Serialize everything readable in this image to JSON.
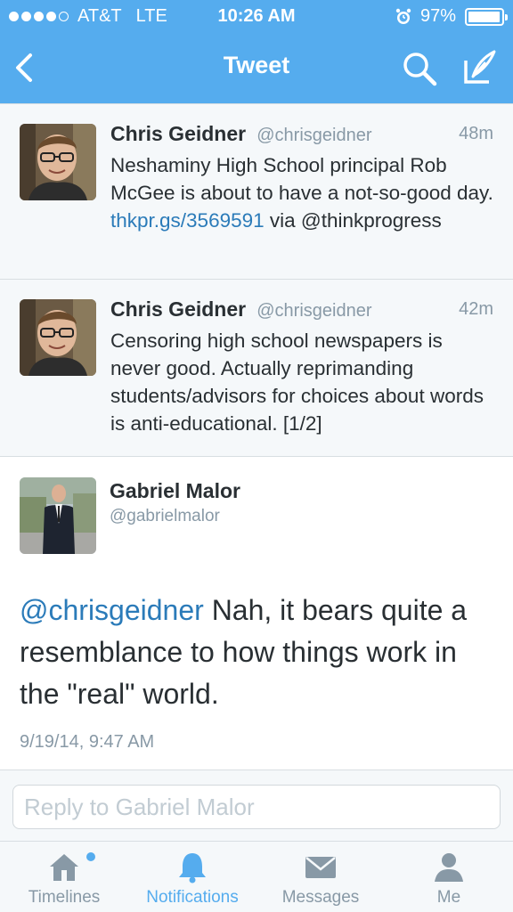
{
  "status_bar": {
    "carrier": "AT&T",
    "network": "LTE",
    "time": "10:26 AM",
    "battery": "97%",
    "battery_level": 0.97,
    "signal_bars": 4
  },
  "nav": {
    "title": "Tweet",
    "back_icon": "chevron-left-icon",
    "search_icon": "search-icon",
    "compose_icon": "compose-icon"
  },
  "tweets": [
    {
      "name": "Chris Geidner",
      "handle": "@chrisgeidner",
      "time": "48m",
      "text_before": "Neshaminy High School principal Rob McGee is about to have a not-so-good day. ",
      "link": "thkpr.gs/3569591",
      "text_after": " via @thinkprogress"
    },
    {
      "name": "Chris Geidner",
      "handle": "@chrisgeidner",
      "time": "42m",
      "text": "Censoring high school newspapers is never good. Actually reprimanding students/advisors for choices about words is anti-educational. [1/2]"
    }
  ],
  "detail": {
    "name": "Gabriel Malor",
    "handle": "@gabrielmalor",
    "mention": "@chrisgeidner",
    "text": " Nah, it bears quite a resemblance to how things work in the \"real\" world.",
    "timestamp": "9/19/14, 9:47 AM"
  },
  "reply": {
    "placeholder": "Reply to Gabriel Malor"
  },
  "tabs": [
    {
      "label": "Timelines",
      "icon": "home-icon",
      "active": false,
      "has_dot": true
    },
    {
      "label": "Notifications",
      "icon": "bell-icon",
      "active": true,
      "has_dot": false
    },
    {
      "label": "Messages",
      "icon": "envelope-icon",
      "active": false,
      "has_dot": false
    },
    {
      "label": "Me",
      "icon": "person-icon",
      "active": false,
      "has_dot": false
    }
  ],
  "colors": {
    "brand": "#55acee",
    "link": "#2b7bb9",
    "muted": "#8899a6",
    "text": "#292f33",
    "background_alt": "#f5f8fa"
  }
}
